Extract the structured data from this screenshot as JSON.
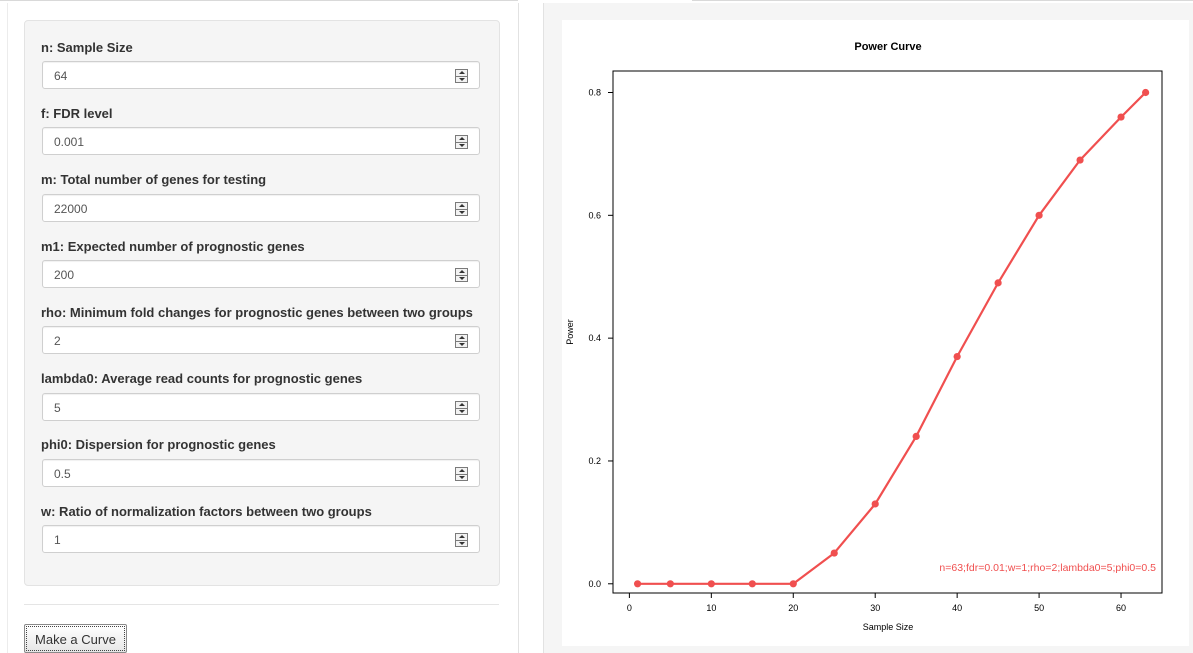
{
  "form": {
    "fields": [
      {
        "label": "n: Sample Size",
        "value": "64"
      },
      {
        "label": "f: FDR level",
        "value": "0.001"
      },
      {
        "label": "m: Total number of genes for testing",
        "value": "22000"
      },
      {
        "label": "m1: Expected number of prognostic genes",
        "value": "200"
      },
      {
        "label": "rho: Minimum fold changes for prognostic genes between two groups",
        "value": "2"
      },
      {
        "label": "lambda0: Average read counts for prognostic genes",
        "value": "5"
      },
      {
        "label": "phi0: Dispersion for prognostic genes",
        "value": "0.5"
      },
      {
        "label": "w: Ratio of normalization factors between two groups",
        "value": "1"
      }
    ],
    "submit_label": "Make a Curve"
  },
  "chart_data": {
    "type": "line",
    "title": "Power Curve",
    "xlabel": "Sample Size",
    "ylabel": "Power",
    "xlim": [
      -2,
      65
    ],
    "ylim": [
      -0.015,
      0.835
    ],
    "xticks": [
      0,
      10,
      20,
      30,
      40,
      50,
      60
    ],
    "yticks": [
      0.0,
      0.2,
      0.4,
      0.6,
      0.8
    ],
    "x": [
      1,
      5,
      10,
      15,
      20,
      25,
      30,
      35,
      40,
      45,
      50,
      55,
      60,
      63
    ],
    "series": [
      {
        "values": [
          0.0,
          0.0,
          0.0,
          0.0,
          0.0,
          0.05,
          0.13,
          0.24,
          0.37,
          0.49,
          0.6,
          0.69,
          0.76,
          0.8
        ],
        "color": "#f04f4f"
      }
    ],
    "annotation": "n=63;fdr=0.01;w=1;rho=2;lambda0=5;phi0=0.5",
    "grid": false
  }
}
